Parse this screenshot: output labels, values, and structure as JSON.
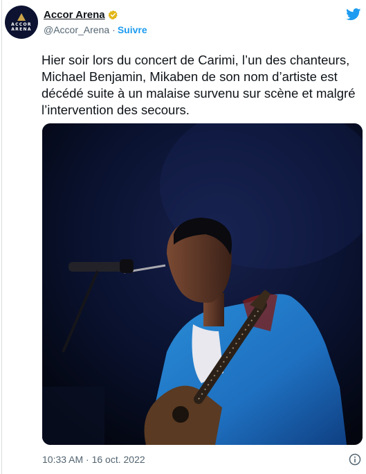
{
  "author": {
    "display_name": "Accor Arena",
    "handle": "@Accor_Arena",
    "separator": "·",
    "follow_label": "Suivre",
    "avatar_line1": "ACCOR",
    "avatar_line2": "ARENA"
  },
  "tweet": {
    "text": "Hier soir lors du concert de Carimi, l’un des chanteurs, Michael Benjamin, Mikaben de son nom d’artiste est décédé suite à un malaise survenu sur scène et malgré l’intervention des secours.",
    "timestamp": "10:33 AM · 16 oct. 2022"
  },
  "icons": {
    "brand": "twitter-bird-icon",
    "verified": "verified-badge-icon",
    "info": "info-icon"
  },
  "colors": {
    "brand_blue": "#1d9bf0",
    "verified_gold": "#e2b719",
    "text": "#0f1419",
    "muted": "#536471"
  }
}
